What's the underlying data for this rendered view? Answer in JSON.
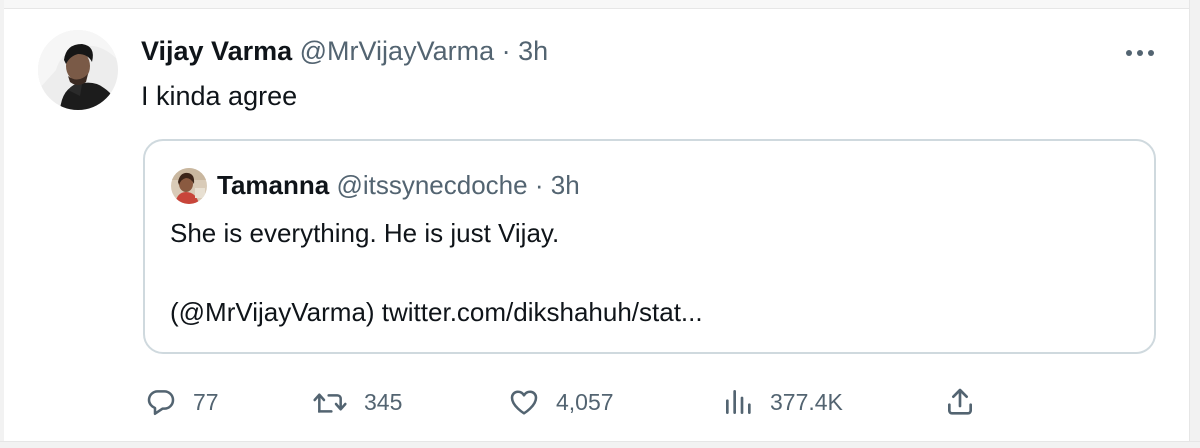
{
  "tweet": {
    "author_name": "Vijay Varma",
    "author_handle": "@MrVijayVarma",
    "separator": "·",
    "time": "3h",
    "text": "I kinda agree",
    "more_icon": "more-horizontal-icon"
  },
  "quoted": {
    "author_name": "Tamanna",
    "author_handle": "@itssynecdoche",
    "separator": "·",
    "time": "3h",
    "line1": "She is everything. He is just Vijay.",
    "line2": "(@MrVijayVarma) twitter.com/dikshahuh/stat..."
  },
  "actions": {
    "replies": "77",
    "retweets": "345",
    "likes": "4,057",
    "views": "377.4K",
    "icons": [
      "reply-icon",
      "retweet-icon",
      "like-icon",
      "views-icon",
      "share-icon"
    ]
  },
  "colors": {
    "text": "#0f1419",
    "secondary": "#536471",
    "border": "#cfd9de"
  }
}
